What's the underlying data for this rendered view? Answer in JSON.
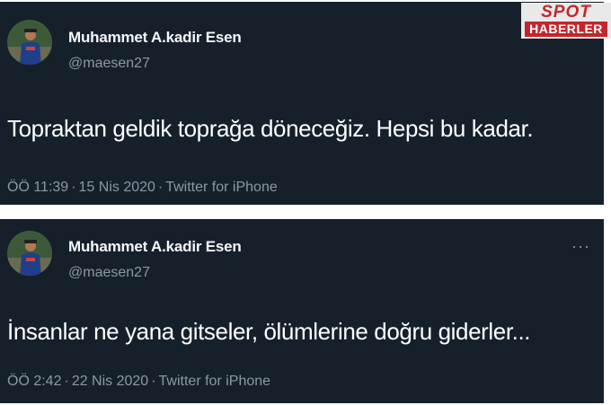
{
  "watermark": {
    "line1": "SPOT",
    "line2": "HABERLER",
    "color": "#c1272d"
  },
  "tweets": [
    {
      "user_name": "Muhammet A.kadir Esen",
      "handle": "@maesen27",
      "text": "Topraktan geldik toprağa döneceğiz. Hepsi bu kadar.",
      "time": "ÖÖ 11:39",
      "date": "15 Nis 2020",
      "source": "Twitter for iPhone",
      "separator": "·"
    },
    {
      "user_name": "Muhammet A.kadir Esen",
      "handle": "@maesen27",
      "text": "İnsanlar ne yana gitseler, ölümlerine doğru giderler...",
      "time": "ÖÖ 2:42",
      "date": "22 Nis 2020",
      "source": "Twitter for iPhone",
      "separator": "·",
      "more_icon": "···"
    }
  ],
  "colors": {
    "background": "#15202b",
    "primary_text": "#ffffff",
    "secondary_text": "#8b98a5"
  }
}
